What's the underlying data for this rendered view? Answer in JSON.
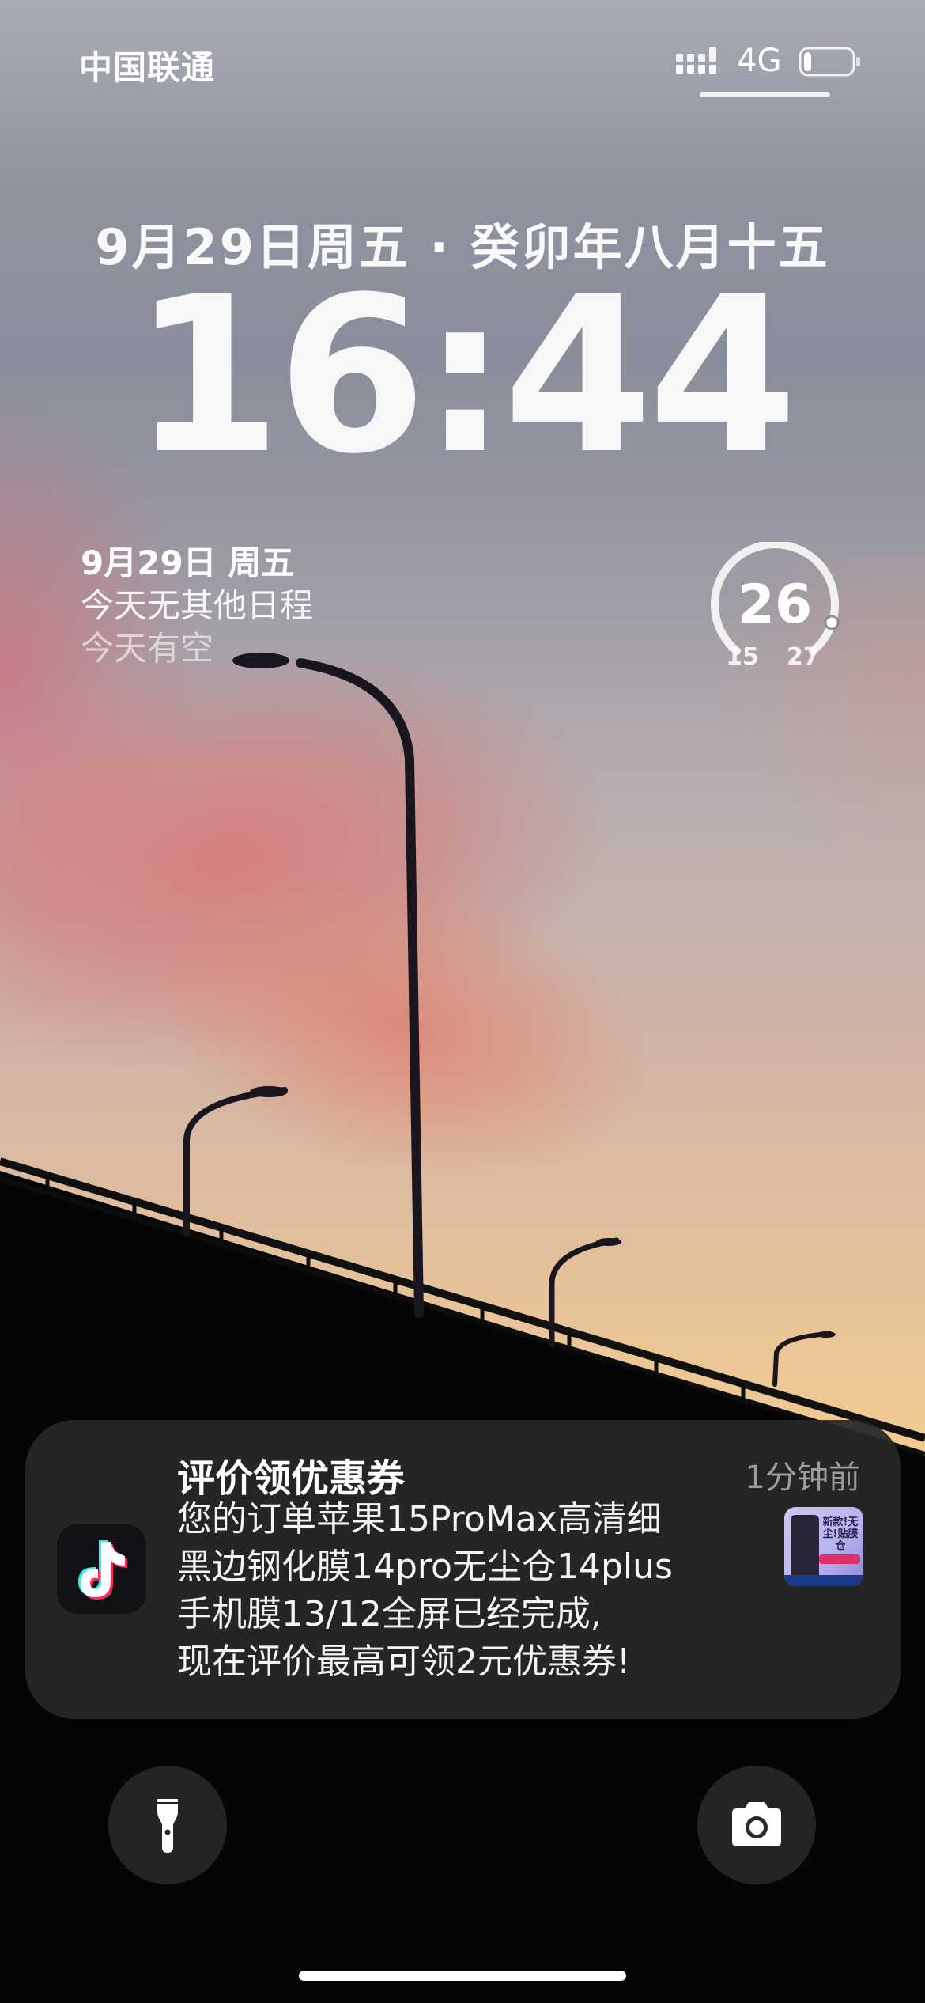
{
  "status_bar": {
    "carrier": "中国联通",
    "network": "4G",
    "signal_icon": "cellular-signal-icon",
    "battery_icon": "battery-icon",
    "battery_level": 0.15
  },
  "lock_screen": {
    "date": "9月29日周五 · 癸卯年八月十五",
    "time": "16:44"
  },
  "calendar_widget": {
    "date": "9月29日 周五",
    "line1": "今天无其他日程",
    "line2": "今天有空"
  },
  "weather_widget": {
    "current": "26",
    "low": "15",
    "high": "27",
    "gauge_level": 0.92
  },
  "notification": {
    "app_icon": "tiktok-icon",
    "title": "评价领优惠券",
    "time": "1分钟前",
    "body_lines": [
      "您的订单苹果15ProMax高清细",
      "黑边钢化膜14pro无尘仓14plus",
      "手机膜13/12全屏已经完成,",
      "现在评价最高可领2元优惠券!"
    ],
    "thumbnail_text": "新款!无尘!贴膜仓"
  },
  "quick_actions": {
    "left_icon": "flashlight-icon",
    "right_icon": "camera-icon"
  },
  "colors": {
    "notification_bg": "#282828",
    "accent_cyan": "#25F4EE",
    "accent_pink": "#FE2C55"
  }
}
